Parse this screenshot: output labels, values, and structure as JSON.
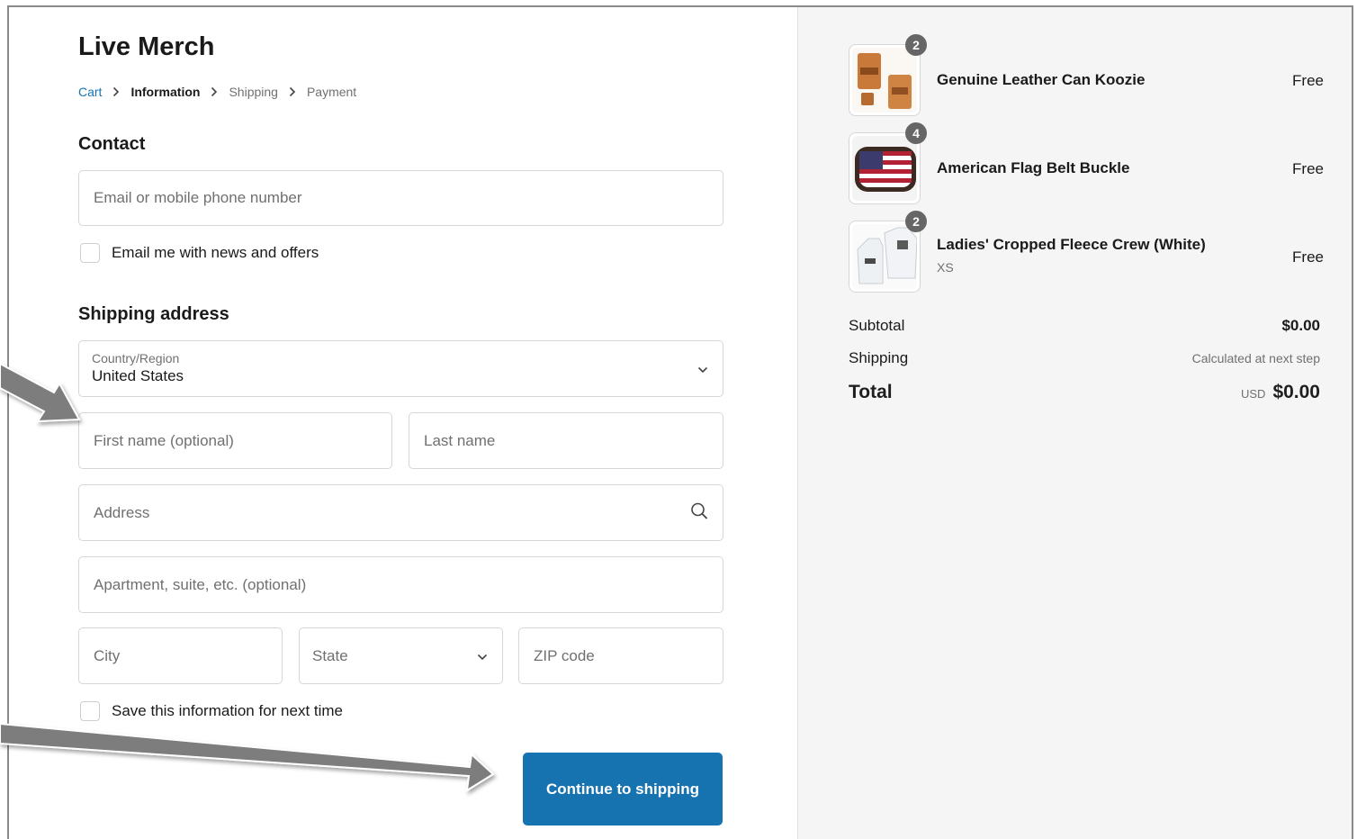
{
  "store": {
    "name": "Live Merch"
  },
  "breadcrumb": {
    "cart": "Cart",
    "information": "Information",
    "shipping": "Shipping",
    "payment": "Payment"
  },
  "contact": {
    "title": "Contact",
    "email_placeholder": "Email or mobile phone number",
    "news_label": "Email me with news and offers"
  },
  "shipping_address": {
    "title": "Shipping address",
    "country_label": "Country/Region",
    "country_value": "United States",
    "first_name_placeholder": "First name (optional)",
    "last_name_placeholder": "Last name",
    "address_placeholder": "Address",
    "apartment_placeholder": "Apartment, suite, etc. (optional)",
    "city_placeholder": "City",
    "state_placeholder": "State",
    "zip_placeholder": "ZIP code",
    "save_label": "Save this information for next time"
  },
  "actions": {
    "continue_label": "Continue to shipping"
  },
  "cart": {
    "items": [
      {
        "name": "Genuine Leather Can Koozie",
        "variant": "",
        "price": "Free",
        "qty": "2"
      },
      {
        "name": "American Flag Belt Buckle",
        "variant": "",
        "price": "Free",
        "qty": "4"
      },
      {
        "name": "Ladies' Cropped Fleece Crew (White)",
        "variant": "XS",
        "price": "Free",
        "qty": "2"
      }
    ],
    "subtotal_label": "Subtotal",
    "subtotal_value": "$0.00",
    "shipping_label": "Shipping",
    "shipping_value": "Calculated at next step",
    "total_label": "Total",
    "total_currency": "USD",
    "total_value": "$0.00"
  },
  "colors": {
    "accent": "#1773b0",
    "sidebar_bg": "#f5f5f5",
    "annotation_arrow": "#7d7d7d"
  }
}
